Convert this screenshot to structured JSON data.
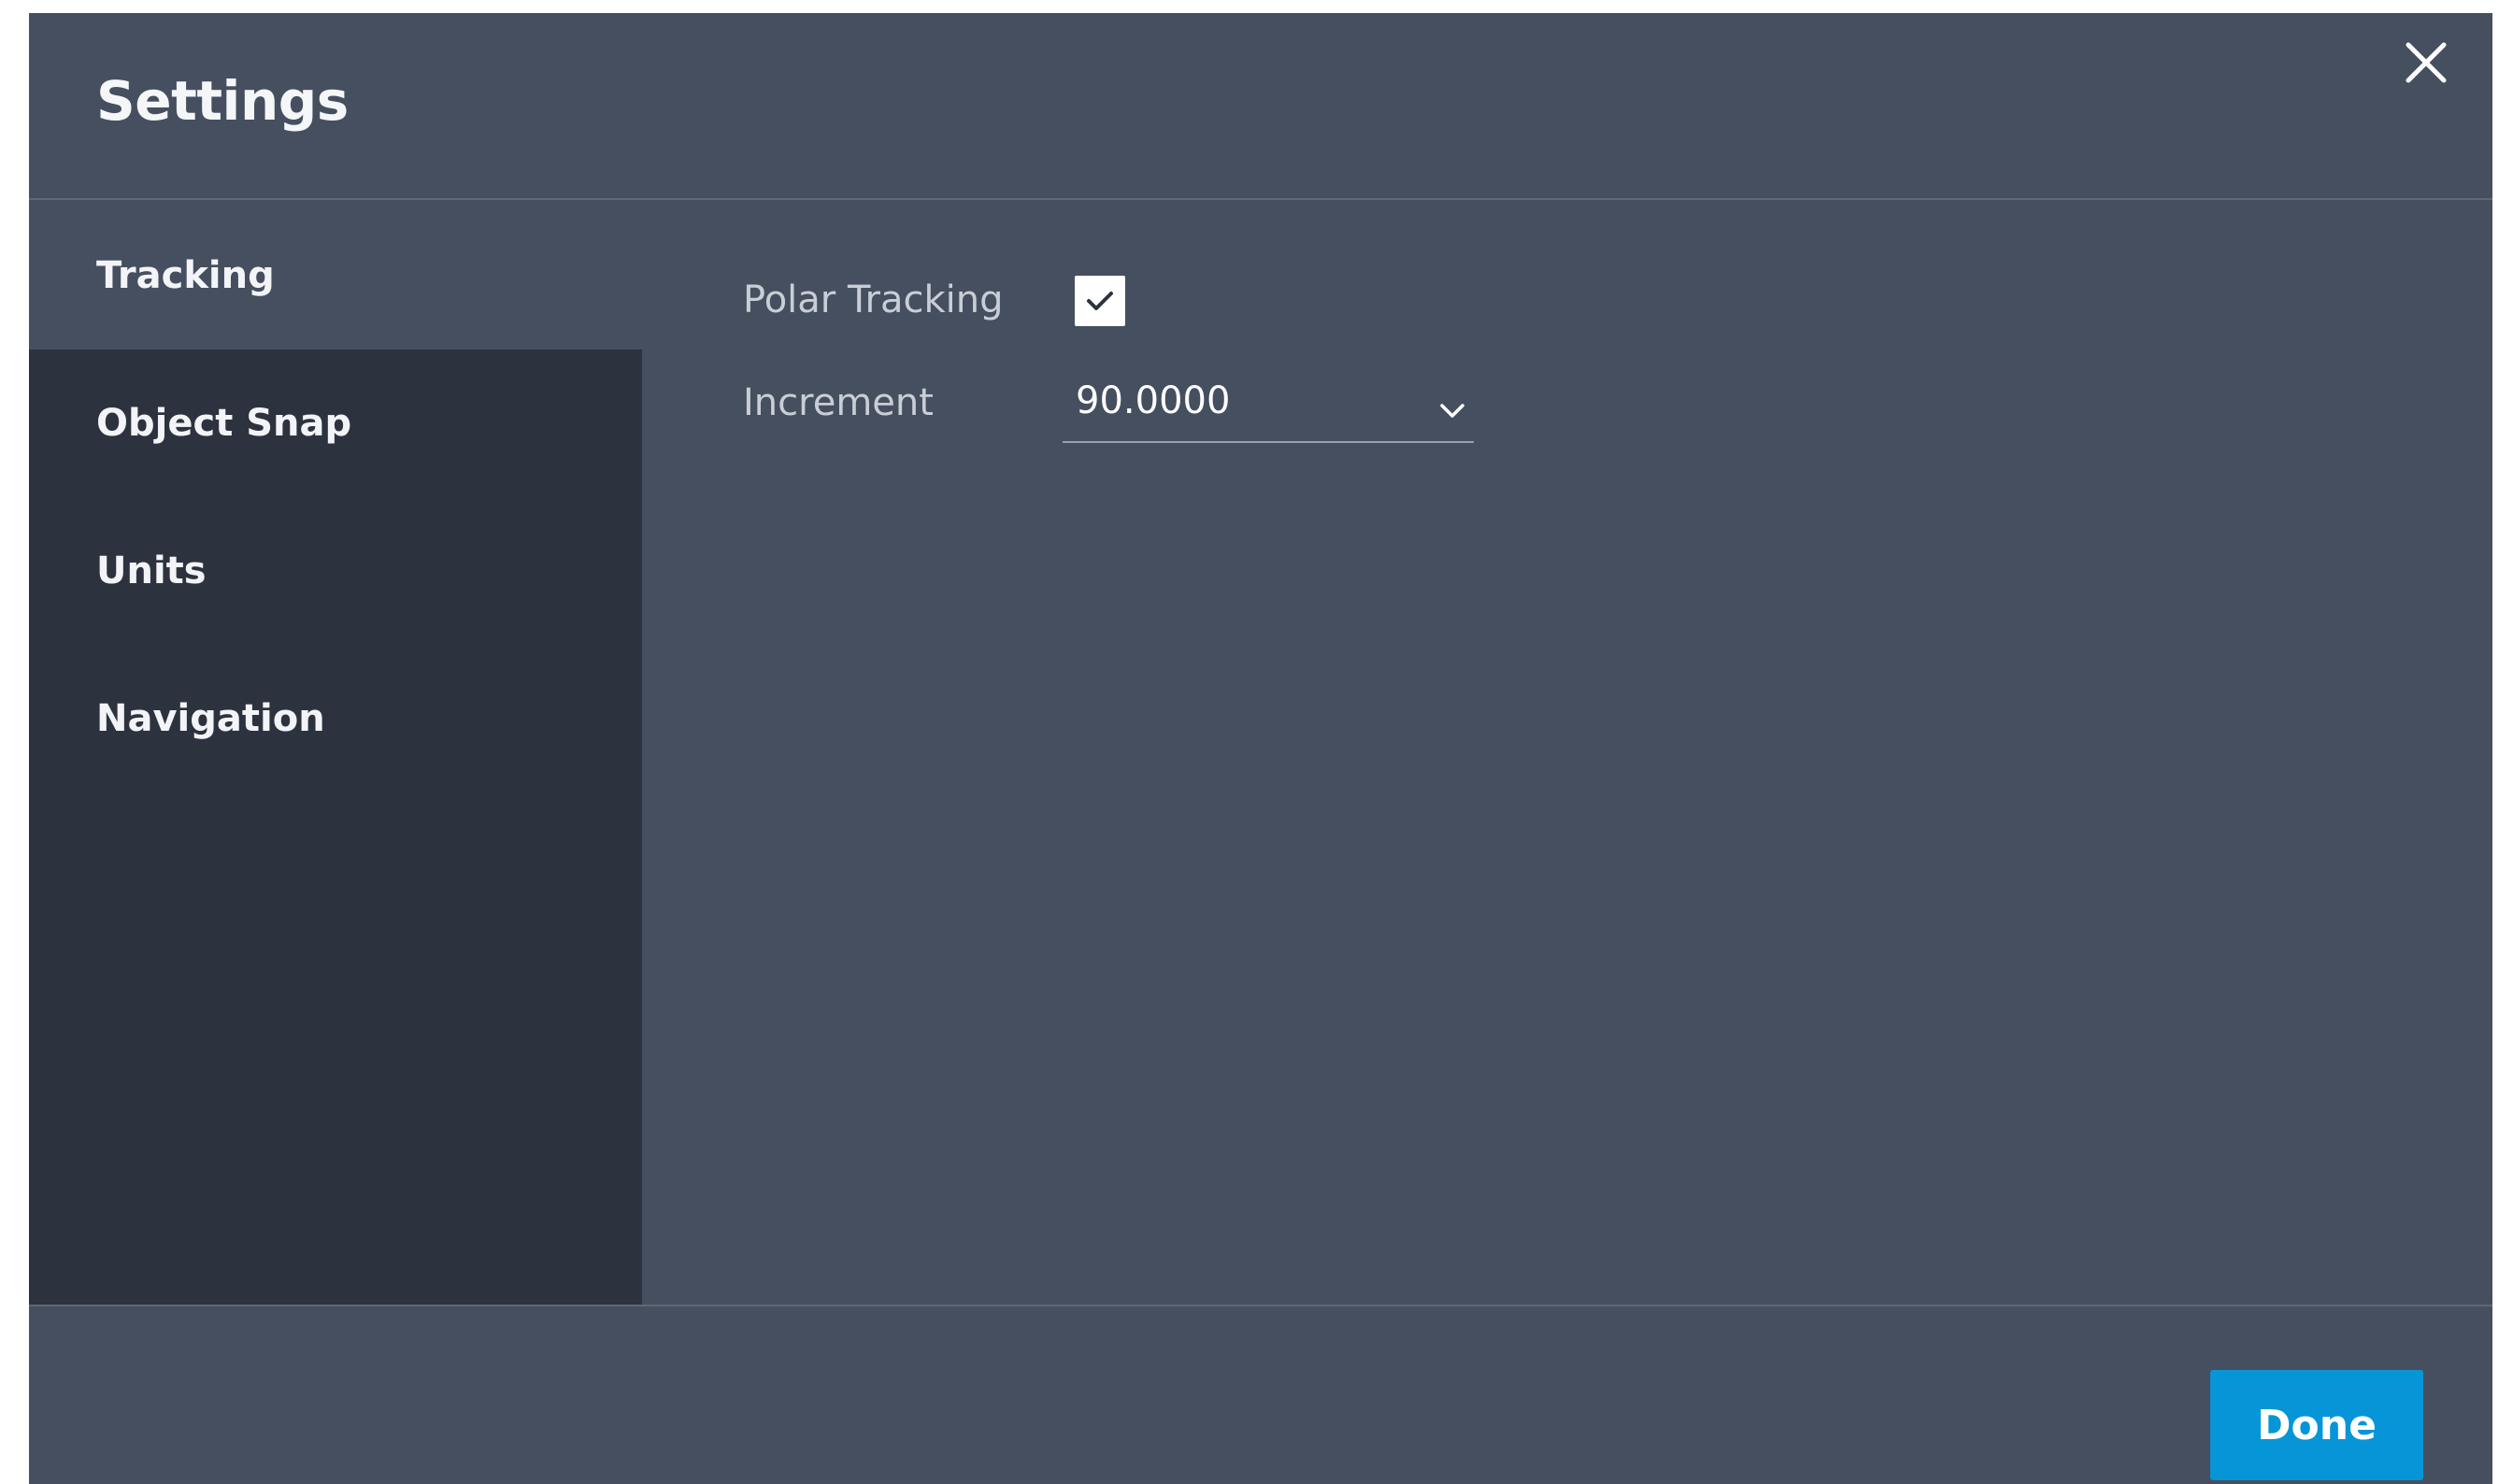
{
  "dialog": {
    "title": "Settings",
    "close_icon": "close-icon"
  },
  "sidebar": {
    "items": [
      {
        "label": "Tracking",
        "active": true
      },
      {
        "label": "Object Snap",
        "active": false
      },
      {
        "label": "Units",
        "active": false
      },
      {
        "label": "Navigation",
        "active": false
      }
    ]
  },
  "tracking": {
    "polar_tracking_label": "Polar Tracking",
    "polar_tracking_checked": true,
    "increment_label": "Increment",
    "increment_value": "90.0000"
  },
  "footer": {
    "done_label": "Done"
  },
  "colors": {
    "dialog_bg": "#454f5f",
    "sidebar_bg": "#2d333e",
    "accent": "#0696d7"
  }
}
